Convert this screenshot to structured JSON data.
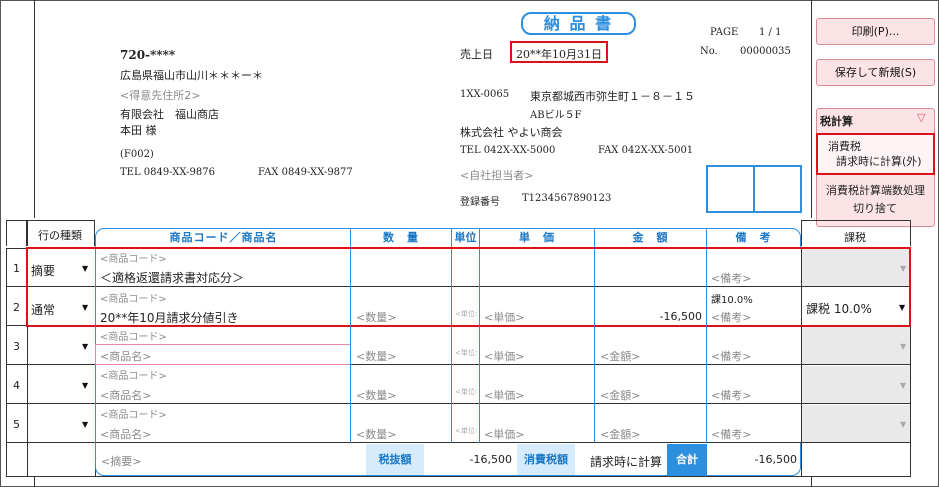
{
  "title": "納 品 書",
  "page": {
    "label": "PAGE",
    "value": "1 / 1"
  },
  "sales_date": {
    "label": "売上日",
    "value": "20**年10月31日"
  },
  "doc_no": {
    "label": "No.",
    "value": "00000035"
  },
  "customer": {
    "postal": "720-****",
    "address": "広島県福山市山川＊＊＊ー＊",
    "address2_placeholder": "<得意先住所2>",
    "company": "有限会社　福山商店",
    "person": "本田 様",
    "code": "(F002)",
    "tel": "TEL 0849-XX-9876",
    "fax": "FAX 0849-XX-9877"
  },
  "own": {
    "postal": "1XX-0065",
    "address1": "東京都城西市弥生町１－８－１５",
    "address2": "ABビル５F",
    "company": "株式会社 やよい商会",
    "tel": "TEL 042X-XX-5000",
    "fax": "FAX 042X-XX-5001",
    "staff_placeholder": "<自社担当者>",
    "reg_label": "登録番号",
    "reg_no": "T1234567890123"
  },
  "side": {
    "print": "印刷(P)...",
    "save_new": "保存して新規(S)",
    "tax_calc": "税計算",
    "tax_mode_1": "消費税",
    "tax_mode_2": "請求時に計算(外)",
    "rounding_1": "消費税計算端数処理",
    "rounding_2": "切り捨て"
  },
  "table": {
    "row_type_header": "行の種類",
    "headers": {
      "product": "商品コード／商品名",
      "qty": "数　量",
      "unit": "単位",
      "price": "単　価",
      "amount": "金　額",
      "note": "備　考",
      "tax": "課税"
    },
    "code_ph": "<商品コード>",
    "name_ph": "<商品名>",
    "qty_ph": "<数量>",
    "unit_ph": "<単位>",
    "price_ph": "<単価>",
    "amount_ph": "<金額>",
    "note_ph": "<備考>",
    "rows": [
      {
        "num": "1",
        "type": "摘要",
        "name": "＜適格返還請求書対応分＞",
        "amount": "",
        "note_top": "",
        "tax": ""
      },
      {
        "num": "2",
        "type": "通常",
        "name": "20**年10月請求分値引き",
        "amount": "-16,500",
        "note_top": "課10.0%",
        "tax": "課税 10.0%"
      },
      {
        "num": "3",
        "type": "",
        "name": "",
        "amount": "",
        "note_top": "",
        "tax": ""
      },
      {
        "num": "4",
        "type": "",
        "name": "",
        "amount": "",
        "note_top": "",
        "tax": ""
      },
      {
        "num": "5",
        "type": "",
        "name": "",
        "amount": "",
        "note_top": "",
        "tax": ""
      }
    ]
  },
  "footer": {
    "memo_ph": "<摘要>",
    "pretax_label": "税抜額",
    "pretax_value": "-16,500",
    "tax_label": "消費税額",
    "tax_value": "請求時に計算",
    "total_label": "合計",
    "total_value": "-16,500"
  }
}
